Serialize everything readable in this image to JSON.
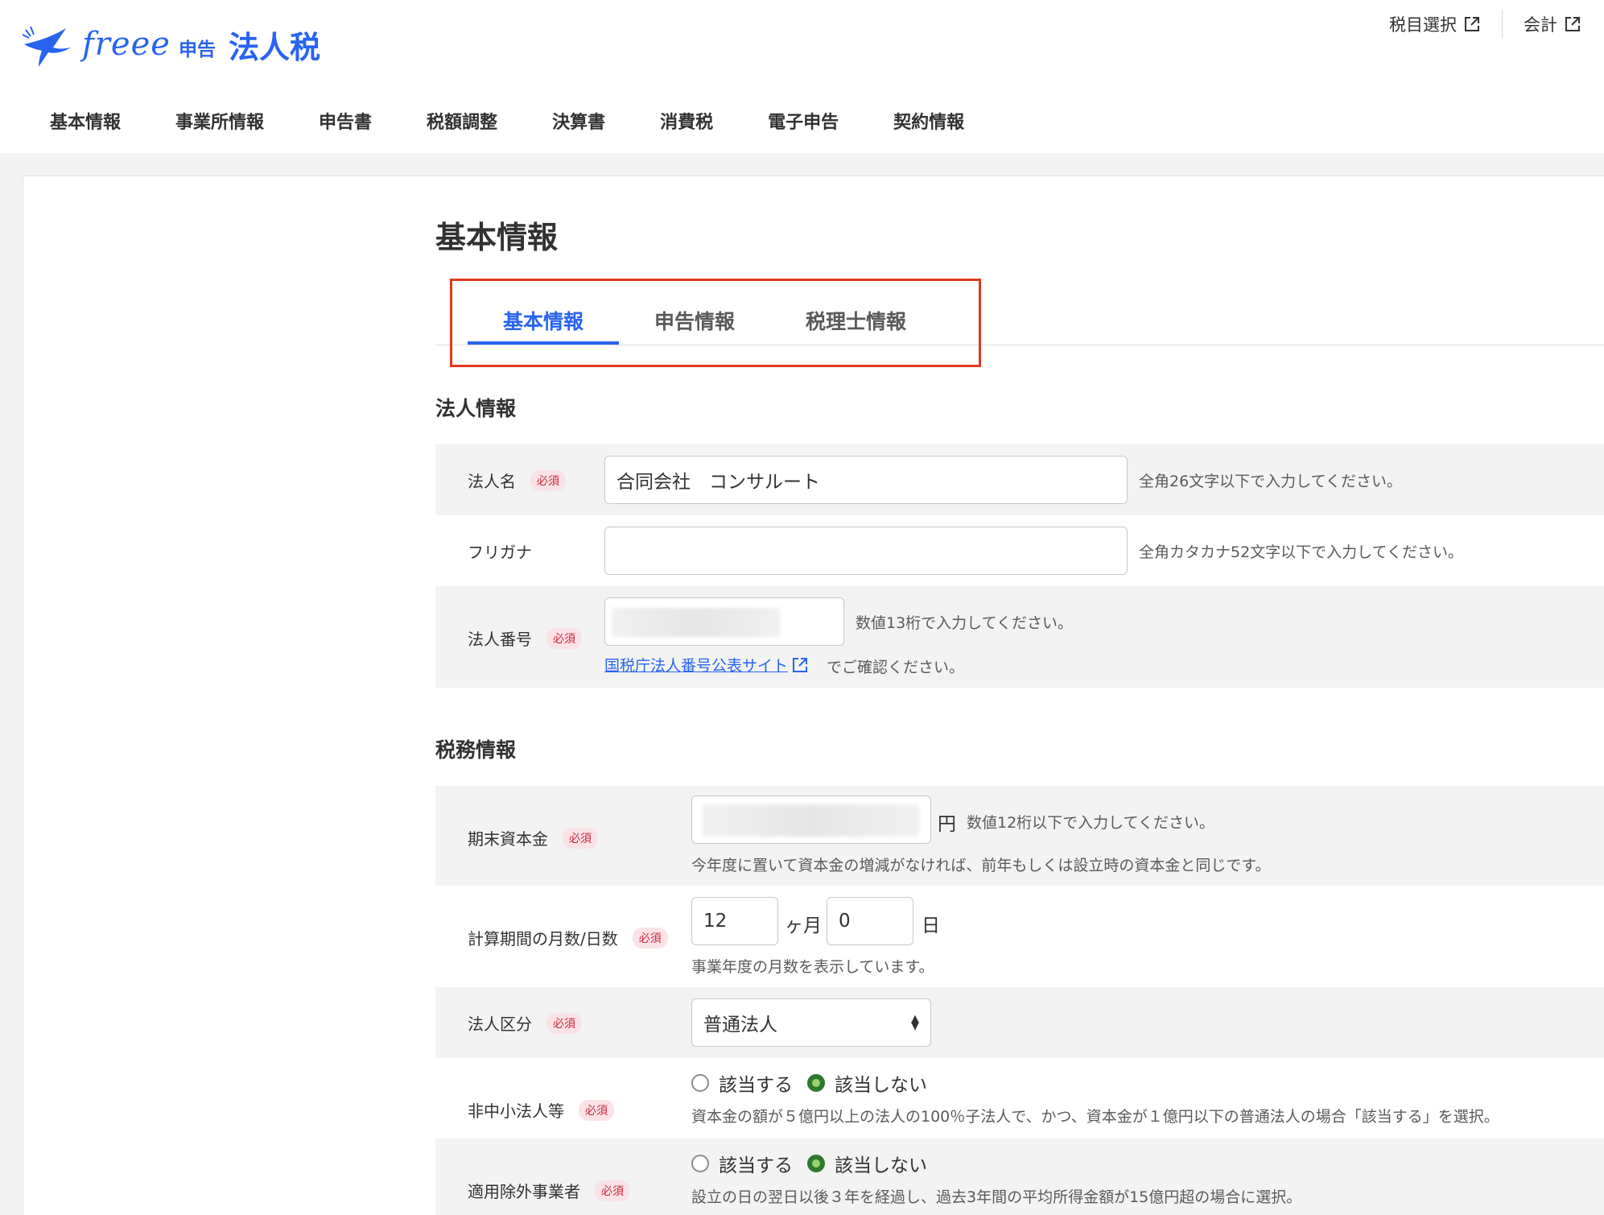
{
  "header": {
    "logo_freee": "freee",
    "logo_shinkoku": "申告",
    "logo_product": "法人税",
    "links": [
      {
        "label": "税目選択",
        "icon": "external-link-icon"
      },
      {
        "label": "会計",
        "icon": "external-link-icon"
      }
    ]
  },
  "main_nav": {
    "items": [
      {
        "label": "基本情報",
        "active": true
      },
      {
        "label": "事業所情報"
      },
      {
        "label": "申告書"
      },
      {
        "label": "税額調整"
      },
      {
        "label": "決算書"
      },
      {
        "label": "消費税"
      },
      {
        "label": "電子申告"
      },
      {
        "label": "契約情報"
      }
    ]
  },
  "page": {
    "title": "基本情報",
    "sub_tabs": [
      {
        "label": "基本情報",
        "active": true
      },
      {
        "label": "申告情報"
      },
      {
        "label": "税理士情報"
      }
    ]
  },
  "corp_section": {
    "title": "法人情報",
    "name": {
      "label": "法人名",
      "required": "必須",
      "value": "合同会社　コンサルート",
      "hint": "全角26文字以下で入力してください。"
    },
    "furigana": {
      "label": "フリガナ",
      "value": "",
      "hint": "全角カタカナ52文字以下で入力してください。"
    },
    "number": {
      "label": "法人番号",
      "required": "必須",
      "hint": "数値13桁で入力してください。",
      "link": "国税庁法人番号公表サイト",
      "link_suffix": "でご確認ください。"
    }
  },
  "tax_section": {
    "title": "税務情報",
    "capital": {
      "label": "期末資本金",
      "required": "必須",
      "unit": "円",
      "hint": "数値12桁以下で入力してください。",
      "note": "今年度に置いて資本金の増減がなければ、前年もしくは設立時の資本金と同じです。"
    },
    "period": {
      "label": "計算期間の月数/日数",
      "required": "必須",
      "months": "12",
      "months_unit": "ヶ月",
      "days": "0",
      "days_unit": "日",
      "note": "事業年度の月数を表示しています。"
    },
    "corp_type": {
      "label": "法人区分",
      "required": "必須",
      "selected": "普通法人"
    },
    "non_sme": {
      "label": "非中小法人等",
      "required": "必須",
      "options": [
        "該当する",
        "該当しない"
      ],
      "selected": "該当しない",
      "note": "資本金の額が５億円以上の法人の100％子法人で、かつ、資本金が１億円以下の普通法人の場合「該当する」を選択。"
    },
    "excluded": {
      "label": "適用除外事業者",
      "required": "必須",
      "options": [
        "該当する",
        "該当しない"
      ],
      "selected": "該当しない",
      "note": "設立の日の翌日以後３年を経過し、過去3年間の平均所得金額が15億円超の場合に選択。"
    }
  },
  "colors": {
    "accent": "#2864f0",
    "highlight_border": "#e0391f",
    "required_bg": "#fbe2e6",
    "required_text": "#c8283c",
    "radio_checked": "#2d7a2d"
  }
}
